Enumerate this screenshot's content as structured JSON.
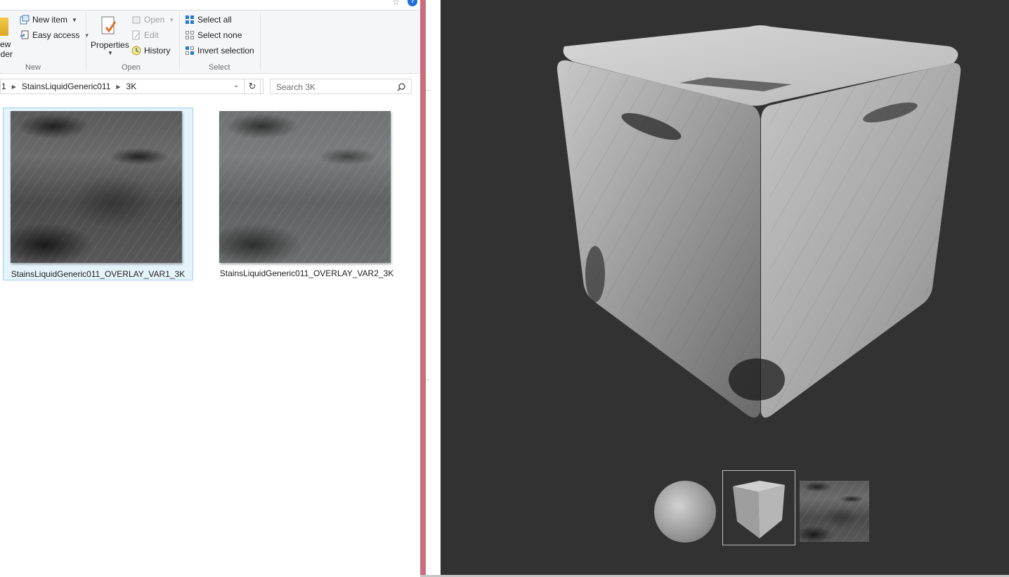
{
  "ribbon": {
    "new_group": {
      "label": "New",
      "new_folder_partial_1": "ew",
      "new_folder_partial_2": "lder",
      "new_item": "New item",
      "easy_access": "Easy access"
    },
    "open_group": {
      "label": "Open",
      "properties": "Properties",
      "open": "Open",
      "edit": "Edit",
      "history": "History"
    },
    "select_group": {
      "label": "Select",
      "select_all": "Select all",
      "select_none": "Select none",
      "invert_selection": "Invert selection"
    }
  },
  "address": {
    "crumb_prefix": "1",
    "crumb_1": "StainsLiquidGeneric011",
    "crumb_2": "3K"
  },
  "search": {
    "placeholder": "Search 3K"
  },
  "files": [
    {
      "name": "StainsLiquidGeneric011_OVERLAY_VAR1_3K",
      "selected": true
    },
    {
      "name": "StainsLiquidGeneric011_OVERLAY_VAR2_3K",
      "selected": false
    }
  ],
  "preview": {
    "background": "#323232",
    "thumbnails": [
      "sphere-preview",
      "cube-preview",
      "flat-texture-preview"
    ],
    "selected_thumbnail": "cube-preview"
  },
  "colors": {
    "selection_bg": "#e5f3fb",
    "selection_border": "#99d1ef",
    "divider": "#c96d7d",
    "help_icon": "#1e6fd9"
  }
}
